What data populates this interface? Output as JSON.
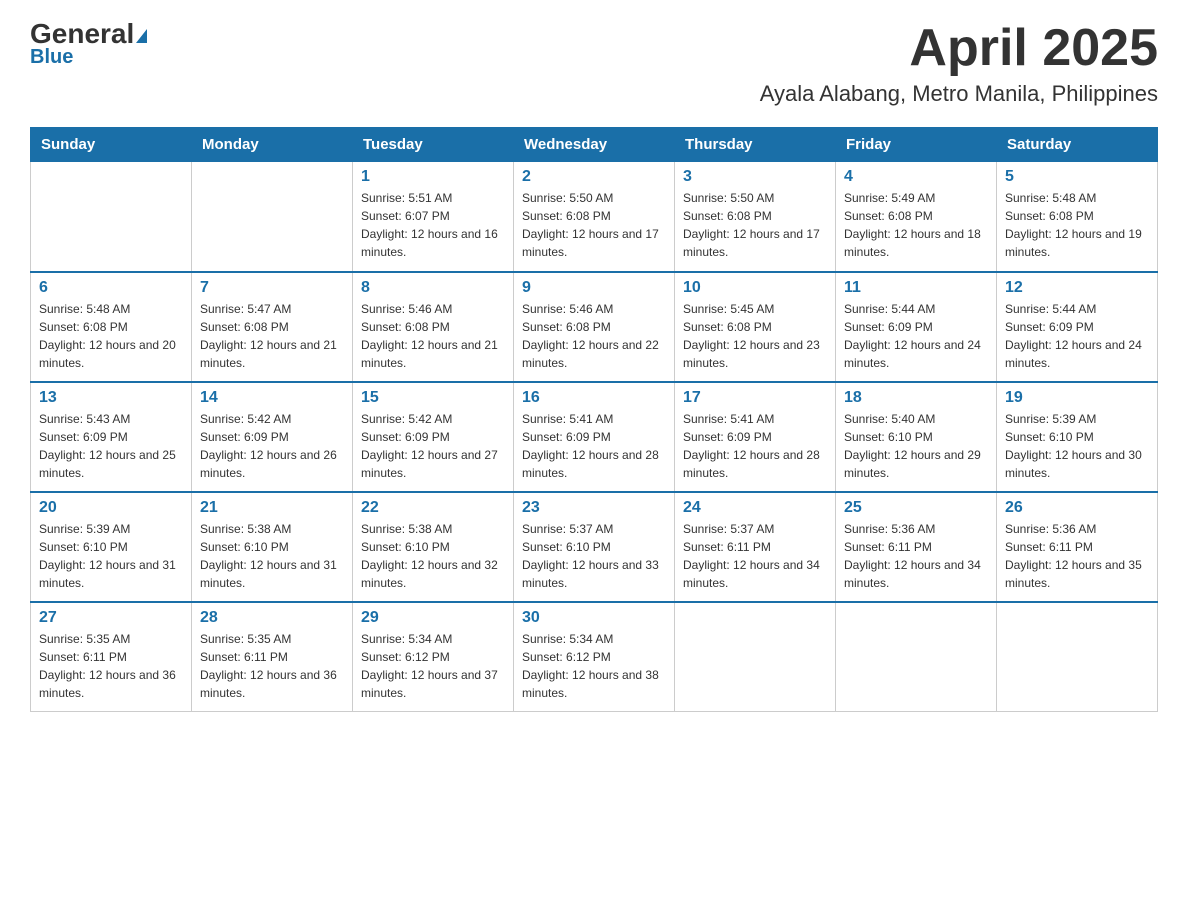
{
  "header": {
    "logo_general": "General",
    "logo_blue": "Blue",
    "title": "April 2025",
    "subtitle": "Ayala Alabang, Metro Manila, Philippines"
  },
  "weekdays": [
    "Sunday",
    "Monday",
    "Tuesday",
    "Wednesday",
    "Thursday",
    "Friday",
    "Saturday"
  ],
  "weeks": [
    [
      {
        "day": "",
        "sunrise": "",
        "sunset": "",
        "daylight": ""
      },
      {
        "day": "",
        "sunrise": "",
        "sunset": "",
        "daylight": ""
      },
      {
        "day": "1",
        "sunrise": "Sunrise: 5:51 AM",
        "sunset": "Sunset: 6:07 PM",
        "daylight": "Daylight: 12 hours and 16 minutes."
      },
      {
        "day": "2",
        "sunrise": "Sunrise: 5:50 AM",
        "sunset": "Sunset: 6:08 PM",
        "daylight": "Daylight: 12 hours and 17 minutes."
      },
      {
        "day": "3",
        "sunrise": "Sunrise: 5:50 AM",
        "sunset": "Sunset: 6:08 PM",
        "daylight": "Daylight: 12 hours and 17 minutes."
      },
      {
        "day": "4",
        "sunrise": "Sunrise: 5:49 AM",
        "sunset": "Sunset: 6:08 PM",
        "daylight": "Daylight: 12 hours and 18 minutes."
      },
      {
        "day": "5",
        "sunrise": "Sunrise: 5:48 AM",
        "sunset": "Sunset: 6:08 PM",
        "daylight": "Daylight: 12 hours and 19 minutes."
      }
    ],
    [
      {
        "day": "6",
        "sunrise": "Sunrise: 5:48 AM",
        "sunset": "Sunset: 6:08 PM",
        "daylight": "Daylight: 12 hours and 20 minutes."
      },
      {
        "day": "7",
        "sunrise": "Sunrise: 5:47 AM",
        "sunset": "Sunset: 6:08 PM",
        "daylight": "Daylight: 12 hours and 21 minutes."
      },
      {
        "day": "8",
        "sunrise": "Sunrise: 5:46 AM",
        "sunset": "Sunset: 6:08 PM",
        "daylight": "Daylight: 12 hours and 21 minutes."
      },
      {
        "day": "9",
        "sunrise": "Sunrise: 5:46 AM",
        "sunset": "Sunset: 6:08 PM",
        "daylight": "Daylight: 12 hours and 22 minutes."
      },
      {
        "day": "10",
        "sunrise": "Sunrise: 5:45 AM",
        "sunset": "Sunset: 6:08 PM",
        "daylight": "Daylight: 12 hours and 23 minutes."
      },
      {
        "day": "11",
        "sunrise": "Sunrise: 5:44 AM",
        "sunset": "Sunset: 6:09 PM",
        "daylight": "Daylight: 12 hours and 24 minutes."
      },
      {
        "day": "12",
        "sunrise": "Sunrise: 5:44 AM",
        "sunset": "Sunset: 6:09 PM",
        "daylight": "Daylight: 12 hours and 24 minutes."
      }
    ],
    [
      {
        "day": "13",
        "sunrise": "Sunrise: 5:43 AM",
        "sunset": "Sunset: 6:09 PM",
        "daylight": "Daylight: 12 hours and 25 minutes."
      },
      {
        "day": "14",
        "sunrise": "Sunrise: 5:42 AM",
        "sunset": "Sunset: 6:09 PM",
        "daylight": "Daylight: 12 hours and 26 minutes."
      },
      {
        "day": "15",
        "sunrise": "Sunrise: 5:42 AM",
        "sunset": "Sunset: 6:09 PM",
        "daylight": "Daylight: 12 hours and 27 minutes."
      },
      {
        "day": "16",
        "sunrise": "Sunrise: 5:41 AM",
        "sunset": "Sunset: 6:09 PM",
        "daylight": "Daylight: 12 hours and 28 minutes."
      },
      {
        "day": "17",
        "sunrise": "Sunrise: 5:41 AM",
        "sunset": "Sunset: 6:09 PM",
        "daylight": "Daylight: 12 hours and 28 minutes."
      },
      {
        "day": "18",
        "sunrise": "Sunrise: 5:40 AM",
        "sunset": "Sunset: 6:10 PM",
        "daylight": "Daylight: 12 hours and 29 minutes."
      },
      {
        "day": "19",
        "sunrise": "Sunrise: 5:39 AM",
        "sunset": "Sunset: 6:10 PM",
        "daylight": "Daylight: 12 hours and 30 minutes."
      }
    ],
    [
      {
        "day": "20",
        "sunrise": "Sunrise: 5:39 AM",
        "sunset": "Sunset: 6:10 PM",
        "daylight": "Daylight: 12 hours and 31 minutes."
      },
      {
        "day": "21",
        "sunrise": "Sunrise: 5:38 AM",
        "sunset": "Sunset: 6:10 PM",
        "daylight": "Daylight: 12 hours and 31 minutes."
      },
      {
        "day": "22",
        "sunrise": "Sunrise: 5:38 AM",
        "sunset": "Sunset: 6:10 PM",
        "daylight": "Daylight: 12 hours and 32 minutes."
      },
      {
        "day": "23",
        "sunrise": "Sunrise: 5:37 AM",
        "sunset": "Sunset: 6:10 PM",
        "daylight": "Daylight: 12 hours and 33 minutes."
      },
      {
        "day": "24",
        "sunrise": "Sunrise: 5:37 AM",
        "sunset": "Sunset: 6:11 PM",
        "daylight": "Daylight: 12 hours and 34 minutes."
      },
      {
        "day": "25",
        "sunrise": "Sunrise: 5:36 AM",
        "sunset": "Sunset: 6:11 PM",
        "daylight": "Daylight: 12 hours and 34 minutes."
      },
      {
        "day": "26",
        "sunrise": "Sunrise: 5:36 AM",
        "sunset": "Sunset: 6:11 PM",
        "daylight": "Daylight: 12 hours and 35 minutes."
      }
    ],
    [
      {
        "day": "27",
        "sunrise": "Sunrise: 5:35 AM",
        "sunset": "Sunset: 6:11 PM",
        "daylight": "Daylight: 12 hours and 36 minutes."
      },
      {
        "day": "28",
        "sunrise": "Sunrise: 5:35 AM",
        "sunset": "Sunset: 6:11 PM",
        "daylight": "Daylight: 12 hours and 36 minutes."
      },
      {
        "day": "29",
        "sunrise": "Sunrise: 5:34 AM",
        "sunset": "Sunset: 6:12 PM",
        "daylight": "Daylight: 12 hours and 37 minutes."
      },
      {
        "day": "30",
        "sunrise": "Sunrise: 5:34 AM",
        "sunset": "Sunset: 6:12 PM",
        "daylight": "Daylight: 12 hours and 38 minutes."
      },
      {
        "day": "",
        "sunrise": "",
        "sunset": "",
        "daylight": ""
      },
      {
        "day": "",
        "sunrise": "",
        "sunset": "",
        "daylight": ""
      },
      {
        "day": "",
        "sunrise": "",
        "sunset": "",
        "daylight": ""
      }
    ]
  ]
}
